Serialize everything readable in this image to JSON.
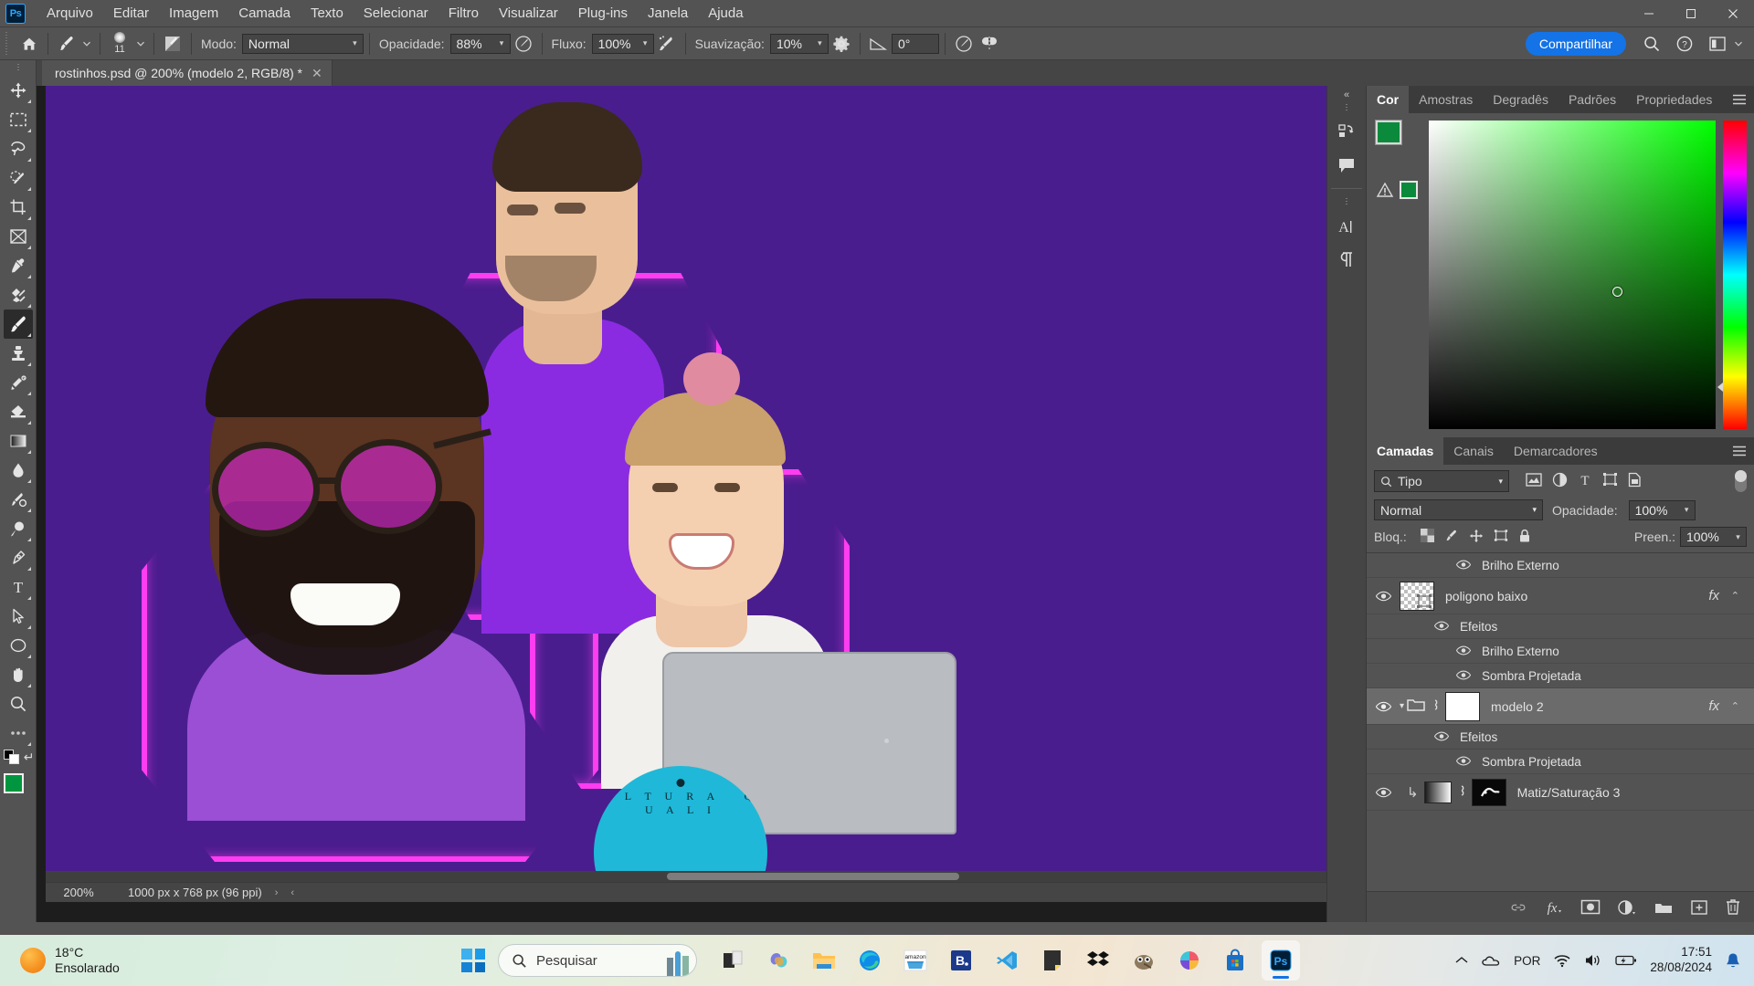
{
  "app": {
    "name": "Adobe Photoshop",
    "logo_text": "Ps"
  },
  "menubar": {
    "items": [
      "Arquivo",
      "Editar",
      "Imagem",
      "Camada",
      "Texto",
      "Selecionar",
      "Filtro",
      "Visualizar",
      "Plug-ins",
      "Janela",
      "Ajuda"
    ]
  },
  "window_controls": {
    "minimize": "—",
    "maximize": "❑",
    "close": "✕"
  },
  "options_bar": {
    "home_icon": "home-icon",
    "brush_preset_icon": "brush-preset-icon",
    "brush_size": "11",
    "brush_settings_icon": "brush-settings-icon",
    "mode_label": "Modo:",
    "mode_value": "Normal",
    "opacity_label": "Opacidade:",
    "opacity_value": "88%",
    "pressure_opacity_icon": "pressure-opacity-icon",
    "flow_label": "Fluxo:",
    "flow_value": "100%",
    "airbrush_icon": "airbrush-icon",
    "smoothing_label": "Suavização:",
    "smoothing_value": "10%",
    "smoothing_options_icon": "gear-icon",
    "angle_icon": "angle-icon",
    "angle_value": "0°",
    "pressure_size_icon": "pressure-size-icon",
    "symmetry_icon": "symmetry-butterfly-icon",
    "share_label": "Compartilhar",
    "search_icon": "search-icon",
    "help_icon": "help-icon",
    "workspace_icon": "workspace-icon",
    "workspace_chevron": "chevron-down-icon"
  },
  "document": {
    "tab_title": "rostinhos.psd @ 200% (modelo 2, RGB/8) *",
    "close_icon": "close-icon"
  },
  "toolbar": {
    "tools": [
      {
        "name": "move-tool",
        "glyph": "move"
      },
      {
        "name": "rectangular-marquee-tool",
        "glyph": "marquee"
      },
      {
        "name": "lasso-tool",
        "glyph": "lasso"
      },
      {
        "name": "object-selection-tool",
        "glyph": "quickselect"
      },
      {
        "name": "crop-tool",
        "glyph": "crop"
      },
      {
        "name": "frame-tool",
        "glyph": "frame"
      },
      {
        "name": "eyedropper-tool",
        "glyph": "eyedropper"
      },
      {
        "name": "healing-brush-tool",
        "glyph": "healing"
      },
      {
        "name": "brush-tool",
        "glyph": "brush",
        "active": true
      },
      {
        "name": "clone-stamp-tool",
        "glyph": "stamp"
      },
      {
        "name": "history-brush-tool",
        "glyph": "historybrush"
      },
      {
        "name": "eraser-tool",
        "glyph": "eraser"
      },
      {
        "name": "gradient-tool",
        "glyph": "gradient"
      },
      {
        "name": "blur-tool",
        "glyph": "blur"
      },
      {
        "name": "dodge-tool",
        "glyph": "dodge"
      },
      {
        "name": "sponge-tool",
        "glyph": "sponge"
      },
      {
        "name": "pen-tool",
        "glyph": "pen"
      },
      {
        "name": "type-tool",
        "glyph": "type"
      },
      {
        "name": "path-selection-tool",
        "glyph": "pathselect"
      },
      {
        "name": "ellipse-tool",
        "glyph": "ellipse"
      },
      {
        "name": "hand-tool",
        "glyph": "hand"
      },
      {
        "name": "zoom-tool",
        "glyph": "zoom"
      },
      {
        "name": "edit-toolbar-button",
        "glyph": "dots"
      }
    ],
    "foreground_color": "#009640",
    "background_color": "#000000"
  },
  "mini_dock": {
    "items": [
      {
        "name": "history-panel-icon",
        "glyph": "history"
      },
      {
        "name": "comments-panel-icon",
        "glyph": "comment"
      },
      {
        "name": "character-panel-icon",
        "glyph": "character"
      },
      {
        "name": "paragraph-panel-icon",
        "glyph": "paragraph"
      }
    ],
    "collapse_icon": "chevron-left-icon"
  },
  "color_panel": {
    "tabs": [
      "Cor",
      "Amostras",
      "Degradês",
      "Padrões",
      "Propriedades"
    ],
    "active_tab": "Cor",
    "menu_icon": "panel-menu-icon",
    "foreground_color": "#0b8a3c",
    "background_color": "#000000",
    "gamut_warning_icon": "gamut-warning-icon",
    "gamut_color": "#0b8a3c"
  },
  "layers_panel": {
    "tabs": [
      "Camadas",
      "Canais",
      "Demarcadores"
    ],
    "active_tab": "Camadas",
    "menu_icon": "panel-menu-icon",
    "filter_label": "Tipo",
    "filter_icon": "search-icon",
    "filter_chevron": "chevron-down-icon",
    "filter_type_icons": [
      "pixel-filter-icon",
      "adjustment-filter-icon",
      "type-filter-icon",
      "shape-filter-icon",
      "smartobject-filter-icon"
    ],
    "filter_toggle": "filter-enable-toggle",
    "blend_mode": "Normal",
    "opacity_label": "Opacidade:",
    "opacity_value": "100%",
    "lock_label": "Bloq.:",
    "lock_icons": [
      "lock-transparent-icon",
      "lock-image-icon",
      "lock-position-icon",
      "lock-artboard-icon",
      "lock-all-icon"
    ],
    "fill_label": "Preen.:",
    "fill_value": "100%",
    "rows": [
      {
        "name": "Brilho Externo",
        "type": "effect",
        "indent": 2,
        "eye": true
      },
      {
        "name": "poligono baixo",
        "type": "layer",
        "eye": true,
        "fx": "fx",
        "caret": "⌃",
        "thumb": "transparent"
      },
      {
        "name": "Efeitos",
        "type": "effect",
        "indent": 1,
        "eye": true
      },
      {
        "name": "Brilho Externo",
        "type": "effect",
        "indent": 2,
        "eye": true
      },
      {
        "name": "Sombra Projetada",
        "type": "effect",
        "indent": 2,
        "eye": true
      },
      {
        "name": "modelo 2",
        "type": "group",
        "eye": true,
        "fx": "fx",
        "caret": "⌃",
        "selected": true,
        "thumb": "white",
        "expand": "⌄",
        "link": true
      },
      {
        "name": "Efeitos",
        "type": "effect",
        "indent": 1,
        "eye": true
      },
      {
        "name": "Sombra Projetada",
        "type": "effect",
        "indent": 2,
        "eye": true
      },
      {
        "name": "Matiz/Saturação 3",
        "type": "adjustment",
        "eye": true,
        "clipped": true,
        "link": true,
        "thumb": "mask"
      }
    ],
    "bottom_icons": [
      {
        "name": "link-layers-icon",
        "glyph": "link"
      },
      {
        "name": "layer-style-icon",
        "glyph": "fx"
      },
      {
        "name": "layer-mask-icon",
        "glyph": "mask"
      },
      {
        "name": "adjustment-layer-icon",
        "glyph": "adjust"
      },
      {
        "name": "new-group-icon",
        "glyph": "folder"
      },
      {
        "name": "new-layer-icon",
        "glyph": "plus"
      },
      {
        "name": "delete-layer-icon",
        "glyph": "trash"
      }
    ]
  },
  "status_bar": {
    "zoom": "200%",
    "dimensions": "1000 px x 768 px (96 ppi)",
    "expand_arrow": "›",
    "prev_arrow": "‹"
  },
  "taskbar": {
    "weather": {
      "temperature": "18°C",
      "condition": "Ensolarado",
      "icon": "sun-icon"
    },
    "start_icon": "windows-start-icon",
    "search_placeholder": "Pesquisar",
    "search_icon": "search-icon",
    "apps": [
      {
        "name": "task-view-icon",
        "label": "Task View"
      },
      {
        "name": "copilot-icon",
        "label": "Copilot"
      },
      {
        "name": "file-explorer-icon",
        "label": "Explorador de Arquivos"
      },
      {
        "name": "microsoft-edge-icon",
        "label": "Microsoft Edge"
      },
      {
        "name": "amazon-icon",
        "label": "Amazon"
      },
      {
        "name": "booking-icon",
        "label": "Booking"
      },
      {
        "name": "vs-code-icon",
        "label": "Visual Studio Code"
      },
      {
        "name": "sticky-notes-icon",
        "label": "Notas Autoadesivas"
      },
      {
        "name": "dropbox-icon",
        "label": "Dropbox"
      },
      {
        "name": "gimp-icon",
        "label": "GIMP"
      },
      {
        "name": "paint-icon",
        "label": "Paint"
      },
      {
        "name": "microsoft-store-icon",
        "label": "Microsoft Store"
      },
      {
        "name": "photoshop-icon",
        "label": "Adobe Photoshop"
      }
    ],
    "tray": {
      "overflow_icon": "chevron-up-icon",
      "cloud_icon": "onedrive-cloud-icon",
      "language": "POR",
      "wifi_icon": "wifi-icon",
      "volume_icon": "volume-icon",
      "battery_icon": "battery-charging-icon",
      "time": "17:51",
      "date": "28/08/2024",
      "notification_icon": "notification-bell-icon"
    }
  },
  "colors": {
    "accent_blue": "#1473e6",
    "panel_bg": "#535353",
    "panel_dark": "#454545",
    "canvas_bg": "#1d1d1d",
    "artwork_purple": "#4a1d8e",
    "neon_pink": "#ff3df0",
    "foreground_green": "#009640"
  }
}
